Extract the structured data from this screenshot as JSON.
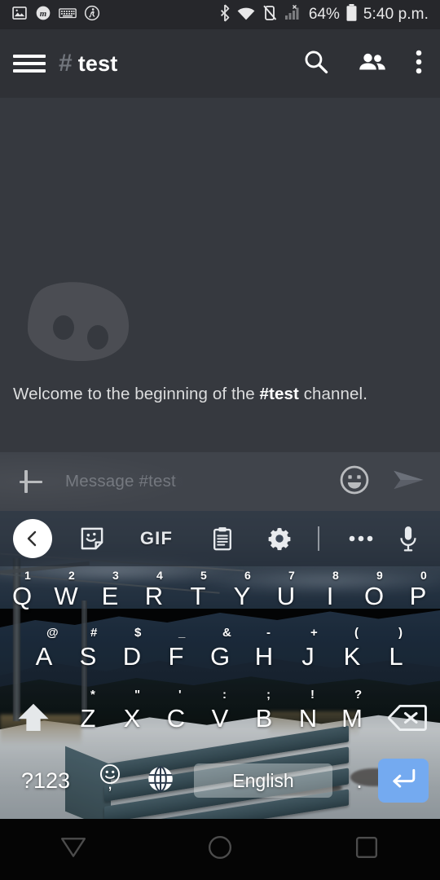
{
  "status_bar": {
    "left_icons": [
      "image-icon",
      "m-badge-icon",
      "keyboard-icon",
      "walking-activity-icon"
    ],
    "right_icons": [
      "bluetooth-icon",
      "wifi-icon",
      "vibrate-off-icon",
      "cellular-no-signal-icon"
    ],
    "battery_percent": "64%",
    "battery_icon": "battery-icon",
    "time": "5:40 p.m."
  },
  "app_bar": {
    "menu_icon": "hamburger-menu-icon",
    "hash": "#",
    "channel_name": "test",
    "actions": [
      "search-icon",
      "members-icon",
      "overflow-menu-icon"
    ]
  },
  "chat": {
    "watermark": "discord-logo-watermark",
    "welcome_prefix": "Welcome to the beginning of the ",
    "welcome_channel": "#test",
    "welcome_suffix": " channel."
  },
  "message_bar": {
    "add_icon": "plus-icon",
    "placeholder": "Message #test",
    "emoji_icon": "emoji-smiley-icon",
    "send_icon": "send-icon"
  },
  "keyboard": {
    "toolbar": [
      {
        "name": "back-arrow-button",
        "label": ""
      },
      {
        "name": "sticker-icon",
        "label": ""
      },
      {
        "name": "gif-button",
        "label": "GIF"
      },
      {
        "name": "clipboard-icon",
        "label": ""
      },
      {
        "name": "settings-gear-icon",
        "label": ""
      },
      {
        "name": "more-options-icon",
        "label": ""
      },
      {
        "name": "microphone-icon",
        "label": ""
      }
    ],
    "row1": [
      {
        "char": "Q",
        "hint": "1"
      },
      {
        "char": "W",
        "hint": "2"
      },
      {
        "char": "E",
        "hint": "3"
      },
      {
        "char": "R",
        "hint": "4"
      },
      {
        "char": "T",
        "hint": "5"
      },
      {
        "char": "Y",
        "hint": "6"
      },
      {
        "char": "U",
        "hint": "7"
      },
      {
        "char": "I",
        "hint": "8"
      },
      {
        "char": "O",
        "hint": "9"
      },
      {
        "char": "P",
        "hint": "0"
      }
    ],
    "row2": [
      {
        "char": "A",
        "hint": "@"
      },
      {
        "char": "S",
        "hint": "#"
      },
      {
        "char": "D",
        "hint": "$"
      },
      {
        "char": "F",
        "hint": "_"
      },
      {
        "char": "G",
        "hint": "&"
      },
      {
        "char": "H",
        "hint": "-"
      },
      {
        "char": "J",
        "hint": "+"
      },
      {
        "char": "K",
        "hint": "("
      },
      {
        "char": "L",
        "hint": ")"
      }
    ],
    "row3": [
      {
        "char": "Z",
        "hint": "*"
      },
      {
        "char": "X",
        "hint": "\""
      },
      {
        "char": "C",
        "hint": "'"
      },
      {
        "char": "V",
        "hint": ":"
      },
      {
        "char": "B",
        "hint": ";"
      },
      {
        "char": "N",
        "hint": "!"
      },
      {
        "char": "M",
        "hint": "?"
      }
    ],
    "shift_icon": "shift-arrow-icon",
    "backspace_icon": "backspace-icon",
    "symbols_key": "?123",
    "emoji_key_icon": "emoji-smiley-icon",
    "comma_key": ",",
    "language_key_icon": "globe-language-icon",
    "space_label": "English",
    "period_key": ".",
    "enter_icon": "enter-return-icon",
    "enter_color": "#74aaf0"
  },
  "nav_bar": {
    "back_icon": "nav-back-triangle-icon",
    "home_icon": "nav-home-circle-icon",
    "recents_icon": "nav-recents-square-icon"
  },
  "colors": {
    "status_bar_bg": "#26272b",
    "app_bar_bg": "#2f3136",
    "chat_bg": "#36393f",
    "input_bg": "#40444b",
    "nav_bg": "#050505",
    "hash_grey": "#72767d",
    "text_primary": "#ffffff",
    "text_secondary": "#dcddde"
  }
}
